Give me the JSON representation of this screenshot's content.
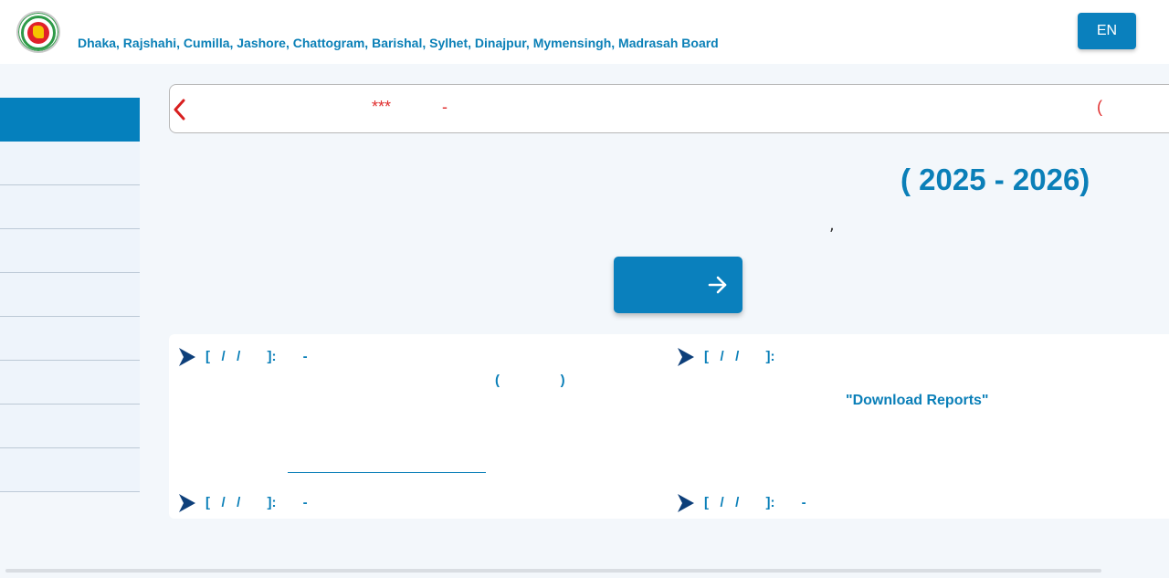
{
  "header": {
    "boards": "Dhaka, Rajshahi, Cumilla, Jashore, Chattogram, Barishal, Sylhet, Dinajpur, Mymensingh, Madrasah Board",
    "language_button": "EN",
    "logo_icon": "government-seal-icon"
  },
  "sidebar": {
    "items": [
      {
        "label": "",
        "active": true
      },
      {
        "label": ""
      },
      {
        "label": ""
      },
      {
        "label": ""
      },
      {
        "label": ""
      },
      {
        "label": ""
      },
      {
        "label": ""
      },
      {
        "label": ""
      },
      {
        "label": ""
      }
    ]
  },
  "ticker": {
    "icon": "chevron-left-icon",
    "stars": "***",
    "dash": "-",
    "paren": "("
  },
  "main": {
    "session_title": "(          2025 - 2026)",
    "comma": ",",
    "go_button_icon": "arrow-right-icon"
  },
  "notices": [
    {
      "line1": "[   /   /       ]:       -",
      "line2": "(                )"
    },
    {
      "line1": "[   /   /       ]:",
      "line2": "\"Download Reports\""
    },
    {
      "line1": "[   /   /       ]:       -"
    },
    {
      "line1": "[   /   /       ]:       -"
    }
  ],
  "colors": {
    "primary": "#0a80bd",
    "accent_red": "#e02d2d",
    "background": "#f3f7fb"
  }
}
